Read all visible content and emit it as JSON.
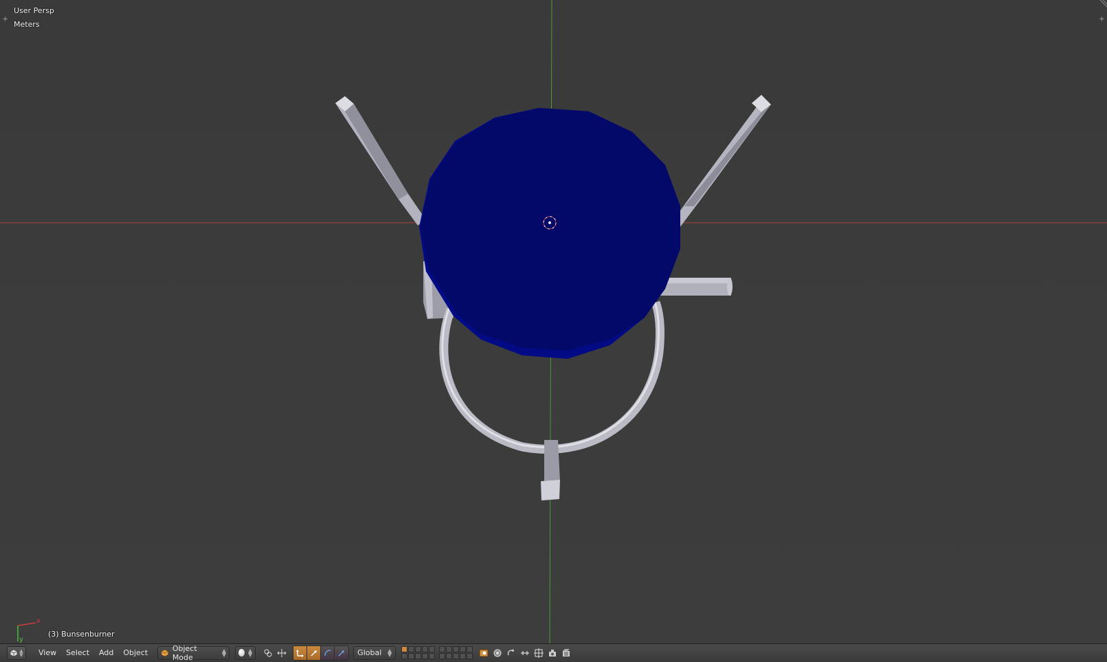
{
  "viewport": {
    "view_name": "User Persp",
    "units": "Meters",
    "object_info": "(3) Bunsenburner",
    "axis_labels": {
      "x": "x",
      "y": "y"
    },
    "colors": {
      "background": "#3b3b3b",
      "x_axis": "#a8443c",
      "y_axis": "#4a9a3a",
      "disk": "#030a6e",
      "disk_edge": "#020a8c",
      "metal": "#b8b8c2"
    }
  },
  "header": {
    "editor_type_icon": "cube-icon",
    "menus": [
      {
        "label": "View"
      },
      {
        "label": "Select"
      },
      {
        "label": "Add"
      },
      {
        "label": "Object"
      }
    ],
    "mode": {
      "label": "Object Mode",
      "icon": "object-mode-icon"
    },
    "shading": {
      "icon": "solid-sphere-icon"
    },
    "pivot": {
      "icon": "pivot-icon"
    },
    "manipulator_icons": [
      "manipulator-toggle-icon",
      "translate-icon",
      "rotate-icon",
      "scale-icon"
    ],
    "orientation": {
      "label": "Global"
    },
    "layer_icons": [
      "lock-layer-icon",
      "render-icon",
      "proportional-edit-icon",
      "snap-icon",
      "snap-target-icon",
      "opengl-render-icon",
      "anim-render-icon"
    ]
  }
}
